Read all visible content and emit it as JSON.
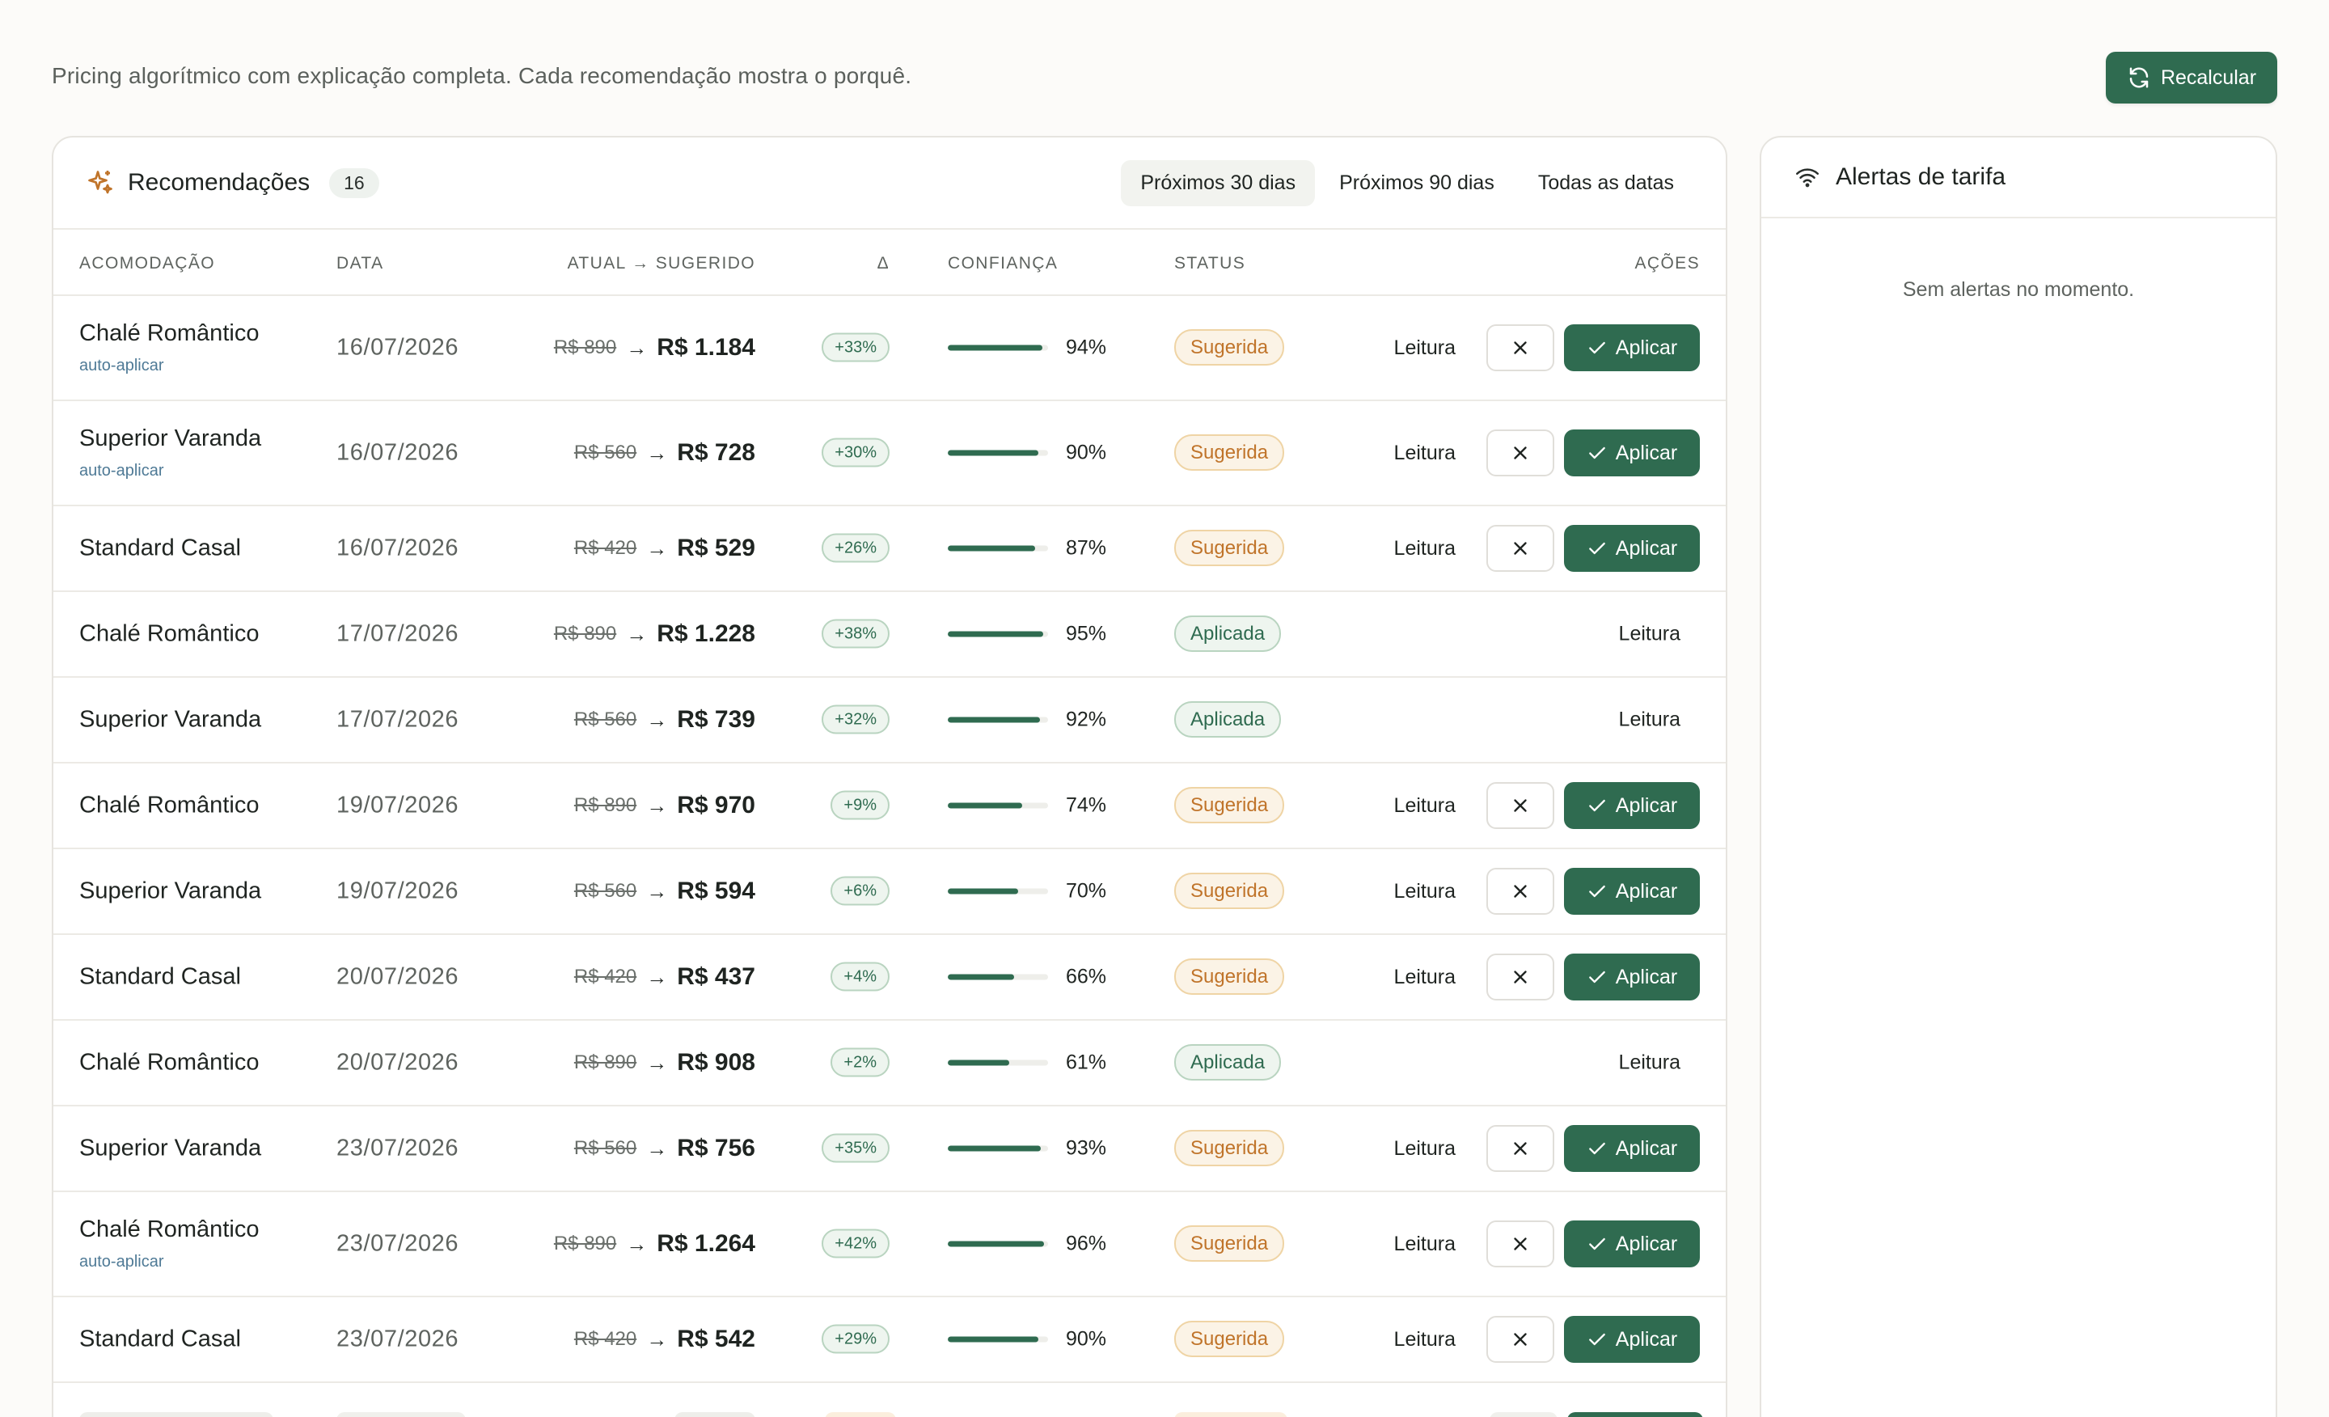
{
  "header": {
    "subtitle": "Pricing algorítmico com explicação completa. Cada recomendação mostra o porquê.",
    "recalc_label": "Recalcular"
  },
  "recommendations": {
    "title": "Recomendações",
    "count": "16",
    "range_tabs": [
      "Próximos 30 dias",
      "Próximos 90 dias",
      "Todas as datas"
    ],
    "active_tab": 0,
    "columns": {
      "room": "ACOMODAÇÃO",
      "date": "DATA",
      "price": "ATUAL → SUGERIDO",
      "delta": "Δ",
      "confidence": "CONFIANÇA",
      "status": "STATUS",
      "actions": "AÇÕES"
    },
    "read_label": "Leitura",
    "apply_label": "Aplicar",
    "auto_label": "auto-aplicar",
    "rows": [
      {
        "room": "Chalé Romântico",
        "auto": true,
        "date": "16/07/2026",
        "old": "R$ 890",
        "new": "R$ 1.184",
        "delta": "+33%",
        "confidence": 94,
        "conf_label": "94%",
        "status": "Sugerida"
      },
      {
        "room": "Superior Varanda",
        "auto": true,
        "date": "16/07/2026",
        "old": "R$ 560",
        "new": "R$ 728",
        "delta": "+30%",
        "confidence": 90,
        "conf_label": "90%",
        "status": "Sugerida"
      },
      {
        "room": "Standard Casal",
        "auto": false,
        "date": "16/07/2026",
        "old": "R$ 420",
        "new": "R$ 529",
        "delta": "+26%",
        "confidence": 87,
        "conf_label": "87%",
        "status": "Sugerida"
      },
      {
        "room": "Chalé Romântico",
        "auto": false,
        "date": "17/07/2026",
        "old": "R$ 890",
        "new": "R$ 1.228",
        "delta": "+38%",
        "confidence": 95,
        "conf_label": "95%",
        "status": "Aplicada"
      },
      {
        "room": "Superior Varanda",
        "auto": false,
        "date": "17/07/2026",
        "old": "R$ 560",
        "new": "R$ 739",
        "delta": "+32%",
        "confidence": 92,
        "conf_label": "92%",
        "status": "Aplicada"
      },
      {
        "room": "Chalé Romântico",
        "auto": false,
        "date": "19/07/2026",
        "old": "R$ 890",
        "new": "R$ 970",
        "delta": "+9%",
        "confidence": 74,
        "conf_label": "74%",
        "status": "Sugerida"
      },
      {
        "room": "Superior Varanda",
        "auto": false,
        "date": "19/07/2026",
        "old": "R$ 560",
        "new": "R$ 594",
        "delta": "+6%",
        "confidence": 70,
        "conf_label": "70%",
        "status": "Sugerida"
      },
      {
        "room": "Standard Casal",
        "auto": false,
        "date": "20/07/2026",
        "old": "R$ 420",
        "new": "R$ 437",
        "delta": "+4%",
        "confidence": 66,
        "conf_label": "66%",
        "status": "Sugerida"
      },
      {
        "room": "Chalé Romântico",
        "auto": false,
        "date": "20/07/2026",
        "old": "R$ 890",
        "new": "R$ 908",
        "delta": "+2%",
        "confidence": 61,
        "conf_label": "61%",
        "status": "Aplicada"
      },
      {
        "room": "Superior Varanda",
        "auto": false,
        "date": "23/07/2026",
        "old": "R$ 560",
        "new": "R$ 756",
        "delta": "+35%",
        "confidence": 93,
        "conf_label": "93%",
        "status": "Sugerida"
      },
      {
        "room": "Chalé Romântico",
        "auto": true,
        "date": "23/07/2026",
        "old": "R$ 890",
        "new": "R$ 1.264",
        "delta": "+42%",
        "confidence": 96,
        "conf_label": "96%",
        "status": "Sugerida"
      },
      {
        "room": "Standard Casal",
        "auto": false,
        "date": "23/07/2026",
        "old": "R$ 420",
        "new": "R$ 542",
        "delta": "+29%",
        "confidence": 90,
        "conf_label": "90%",
        "status": "Sugerida"
      }
    ]
  },
  "alerts": {
    "title": "Alertas de tarifa",
    "empty_text": "Sem alertas no momento."
  },
  "colors": {
    "accent": "#2f6b50",
    "suggested": "#c0742a",
    "applied": "#2f6b50",
    "link": "#4f7a96"
  }
}
